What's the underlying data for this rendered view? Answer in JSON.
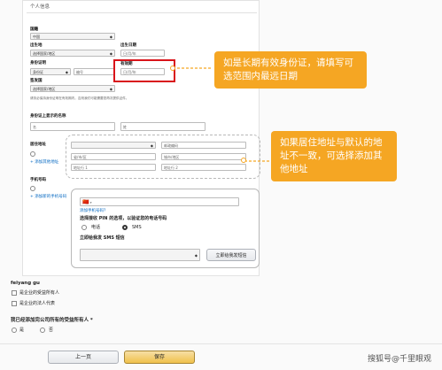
{
  "page": {
    "title": "个人信息"
  },
  "form": {
    "nationality": {
      "label": "国籍",
      "value": "中国"
    },
    "birthplace": {
      "label": "出生地",
      "placeholder": "选择国家/地区"
    },
    "birthdate": {
      "label": "出生日期",
      "placeholder": "日/月/年"
    },
    "id_proof": {
      "label": "身份证明",
      "type_value": "身份证",
      "number_placeholder": "编号"
    },
    "expiry": {
      "label": "有效期",
      "placeholder": "日/月/年"
    },
    "issue_country": {
      "label": "签发国",
      "placeholder": "选择国家/地区"
    },
    "note": "请务必保持身份证明在有效期内，否则我们可能需要您再次提供证件。",
    "name_section": {
      "label": "身份证上显示的名称",
      "first_placeholder": "名",
      "last_placeholder": "姓"
    },
    "address_section": {
      "label": "居住地址",
      "add_link": "+ 添加其他地址",
      "country_placeholder": "",
      "zip_placeholder": "邮政编码",
      "line1_placeholder": "省/市/区",
      "city_placeholder": "城市/地区",
      "line2_placeholder": "地址行 1",
      "line3_placeholder": "地址行 2"
    },
    "phone_section": {
      "label": "手机号码",
      "add_link": "+ 添加新的手机号码",
      "flag": "🇨🇳",
      "other_number_link": "添加手机号码？",
      "select_method": "选择接收 PIN 的选项，以验证您的电话号码",
      "option_call": "电话",
      "option_sms": "SMS",
      "language_label": "立即给我发 SMS 短信",
      "send_button": "立即给我发短信"
    },
    "owner_section": {
      "name": "feiyang gu",
      "checkbox1": "是企业的受益所有人",
      "checkbox2": "是企业的法人代表"
    },
    "beneficial_question": {
      "label": "我已经添加完公司所有的受益所有人 *",
      "yes": "是",
      "no": "否"
    },
    "buttons": {
      "prev": "上一页",
      "save": "保存"
    }
  },
  "callouts": {
    "first": "如是长期有效身份证，请填写可选范围内最远日期",
    "second": "如果居住地址与默认的地址不一致，可选择添加其他地址"
  },
  "watermark": "搜狐号@千里眼观",
  "colors": {
    "accent": "#f5a623",
    "highlight": "#d9141a",
    "link": "#0066c0"
  }
}
